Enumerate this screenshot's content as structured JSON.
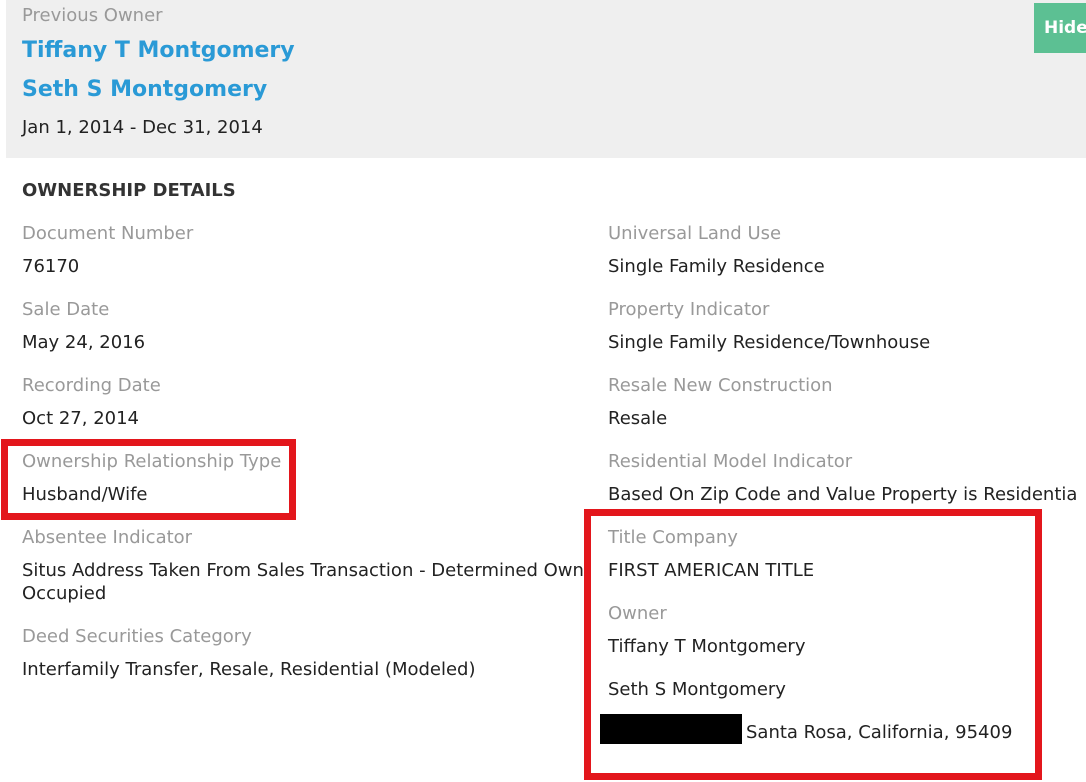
{
  "header": {
    "label": "Previous Owner",
    "owners": [
      "Tiffany T Montgomery",
      "Seth S Montgomery"
    ],
    "date_range": "Jan 1, 2014 - Dec 31, 2014",
    "hide_label": "Hide"
  },
  "section_title": "OWNERSHIP DETAILS",
  "left": [
    {
      "label": "Document Number",
      "value": "76170"
    },
    {
      "label": "Sale Date",
      "value": "May 24, 2016"
    },
    {
      "label": "Recording Date",
      "value": "Oct 27, 2014"
    },
    {
      "label": "Ownership Relationship Type",
      "value": "Husband/Wife"
    },
    {
      "label": "Absentee Indicator",
      "value_line1": "Situs Address Taken From Sales Transaction - Determined Owner",
      "value_line2": "Occupied"
    },
    {
      "label": "Deed Securities Category",
      "value": "Interfamily Transfer, Resale, Residential (Modeled)"
    }
  ],
  "right": [
    {
      "label": "Universal Land Use",
      "value": "Single Family Residence"
    },
    {
      "label": "Property Indicator",
      "value": "Single Family Residence/Townhouse"
    },
    {
      "label": "Resale New Construction",
      "value": "Resale"
    },
    {
      "label": "Residential Model Indicator",
      "value": "Based On Zip Code and Value Property is Residential"
    },
    {
      "label": "Title Company",
      "value": "FIRST AMERICAN TITLE"
    }
  ],
  "owner_block": {
    "label": "Owner",
    "names": [
      "Tiffany T Montgomery",
      "Seth S Montgomery"
    ],
    "address_tail": "Santa Rosa, California, 95409"
  },
  "colors": {
    "link": "#2a9ad6",
    "hide_button": "#5cc093",
    "annotation": "#e3161c"
  }
}
